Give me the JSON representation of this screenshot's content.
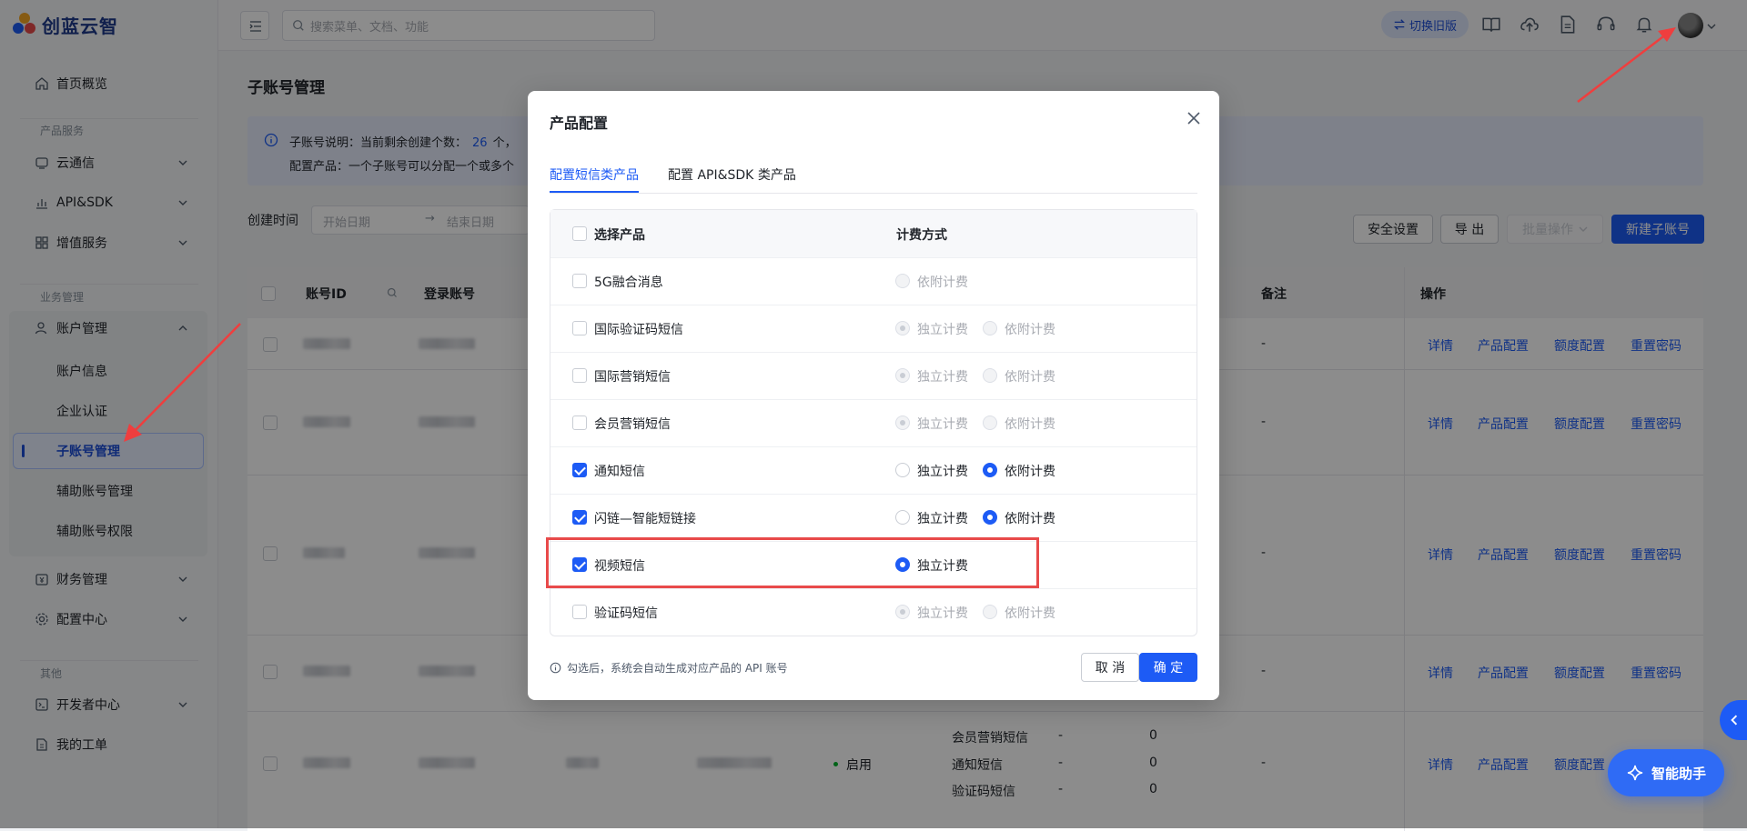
{
  "app": {
    "logo_text": "创蓝云智"
  },
  "topbar": {
    "search_placeholder": "搜索菜单、文档、功能",
    "switch_label": "切换旧版"
  },
  "sidebar": {
    "home": "首页概览",
    "group_product": "产品服务",
    "items_product": [
      "云通信",
      "API&SDK",
      "增值服务"
    ],
    "group_business": "业务管理",
    "account_mgmt": "账户管理",
    "account_sub": [
      "账户信息",
      "企业认证",
      "子账号管理",
      "辅助账号管理",
      "辅助账号权限"
    ],
    "finance": "财务管理",
    "config": "配置中心",
    "group_other": "其他",
    "developer": "开发者中心",
    "tickets": "我的工单"
  },
  "page": {
    "title": "子账号管理",
    "info_line1_prefix": "子账号说明：当前剩余创建个数：",
    "info_count": "26",
    "info_line1_suffix": "个，",
    "info_line2": "配置产品：一个子账号可以分配一个或多个",
    "filter_label": "创建时间",
    "date_start": "开始日期",
    "date_end": "结束日期",
    "btn_security": "安全设置",
    "btn_export": "导 出",
    "btn_batch": "批量操作",
    "btn_new": "新建子账号"
  },
  "table": {
    "headers": {
      "id": "账号ID",
      "login": "登录账号",
      "remark": "备注",
      "ops": "操作"
    },
    "ops": [
      "详情",
      "产品配置",
      "额度配置",
      "重置密码"
    ],
    "dash": "-",
    "last_row_status": "启用",
    "last_row_products": [
      {
        "name": "会员营销短信",
        "a": "-",
        "b": "0"
      },
      {
        "name": "通知短信",
        "a": "-",
        "b": "0"
      },
      {
        "name": "验证码短信",
        "a": "-",
        "b": "0"
      }
    ]
  },
  "modal": {
    "title": "产品配置",
    "tab_sms": "配置短信类产品",
    "tab_api": "配置 API&SDK 类产品",
    "col_product": "选择产品",
    "col_billing": "计费方式",
    "opt_independent": "独立计费",
    "opt_attached": "依附计费",
    "products": [
      {
        "name": "5G融合消息",
        "checked": false
      },
      {
        "name": "国际验证码短信",
        "checked": false
      },
      {
        "name": "国际营销短信",
        "checked": false
      },
      {
        "name": "会员营销短信",
        "checked": false
      },
      {
        "name": "通知短信",
        "checked": true
      },
      {
        "name": "闪链—智能短链接",
        "checked": true
      },
      {
        "name": "视频短信",
        "checked": true
      },
      {
        "name": "验证码短信",
        "checked": false
      }
    ],
    "note": "勾选后，系统会自动生成对应产品的 API 账号",
    "cancel": "取 消",
    "confirm": "确 定"
  },
  "assistant": {
    "label": "智能助手"
  },
  "colors": {
    "primary": "#1d5bf5",
    "highlight": "#e84a4a"
  }
}
